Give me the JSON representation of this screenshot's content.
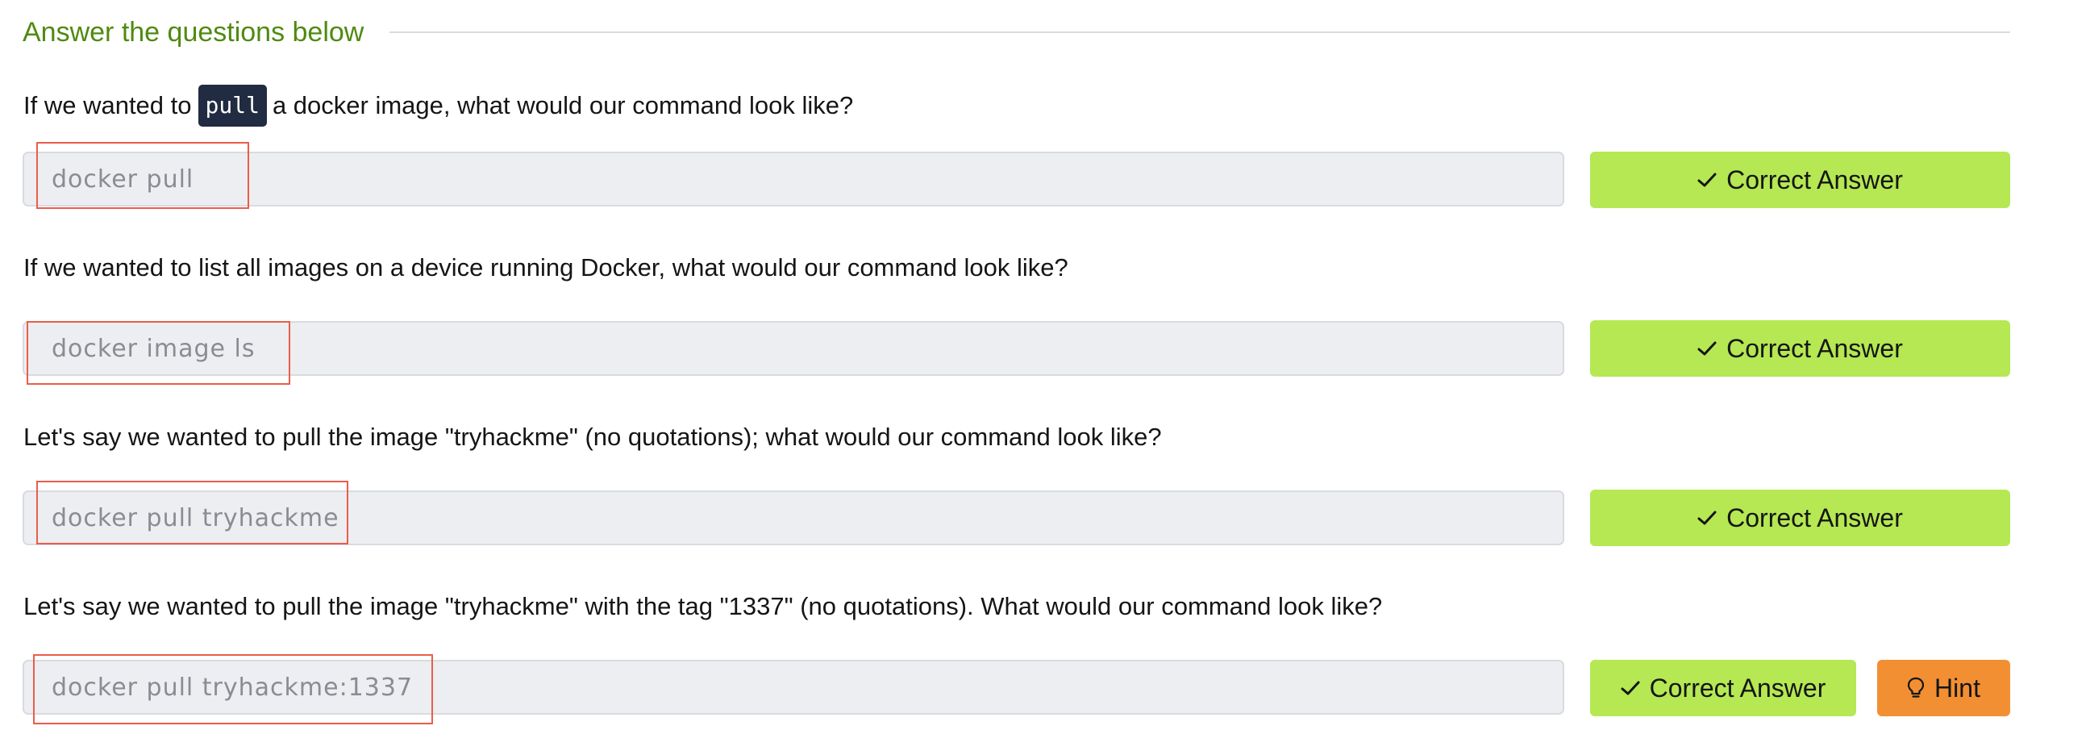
{
  "section": {
    "title": "Answer the questions below"
  },
  "questions": [
    {
      "text_before": "If we wanted to",
      "code": "pull",
      "text_after": "a docker image, what would our command look like?",
      "answer": "docker pull",
      "button_label": "Correct Answer"
    },
    {
      "text": "If we wanted to list all images on a device running Docker, what would our command look like?",
      "answer": "docker image ls",
      "button_label": "Correct Answer"
    },
    {
      "text": "Let's say we wanted to pull the image \"tryhackme\" (no quotations); what would our command look like?",
      "answer": "docker pull tryhackme",
      "button_label": "Correct Answer"
    },
    {
      "text": "Let's say we wanted to pull the image \"tryhackme\" with the tag \"1337\" (no quotations). What would our command look like?",
      "answer": "docker pull tryhackme:1337",
      "button_label": "Correct Answer",
      "hint_label": "Hint"
    }
  ],
  "icons": {
    "correct": "check-icon",
    "hint": "lightbulb-icon"
  },
  "colors": {
    "title": "#4f8a10",
    "correct_button": "#b5e853",
    "hint_button": "#f28f33",
    "code_background": "#212c42",
    "highlight_box": "#ea5d4b"
  }
}
